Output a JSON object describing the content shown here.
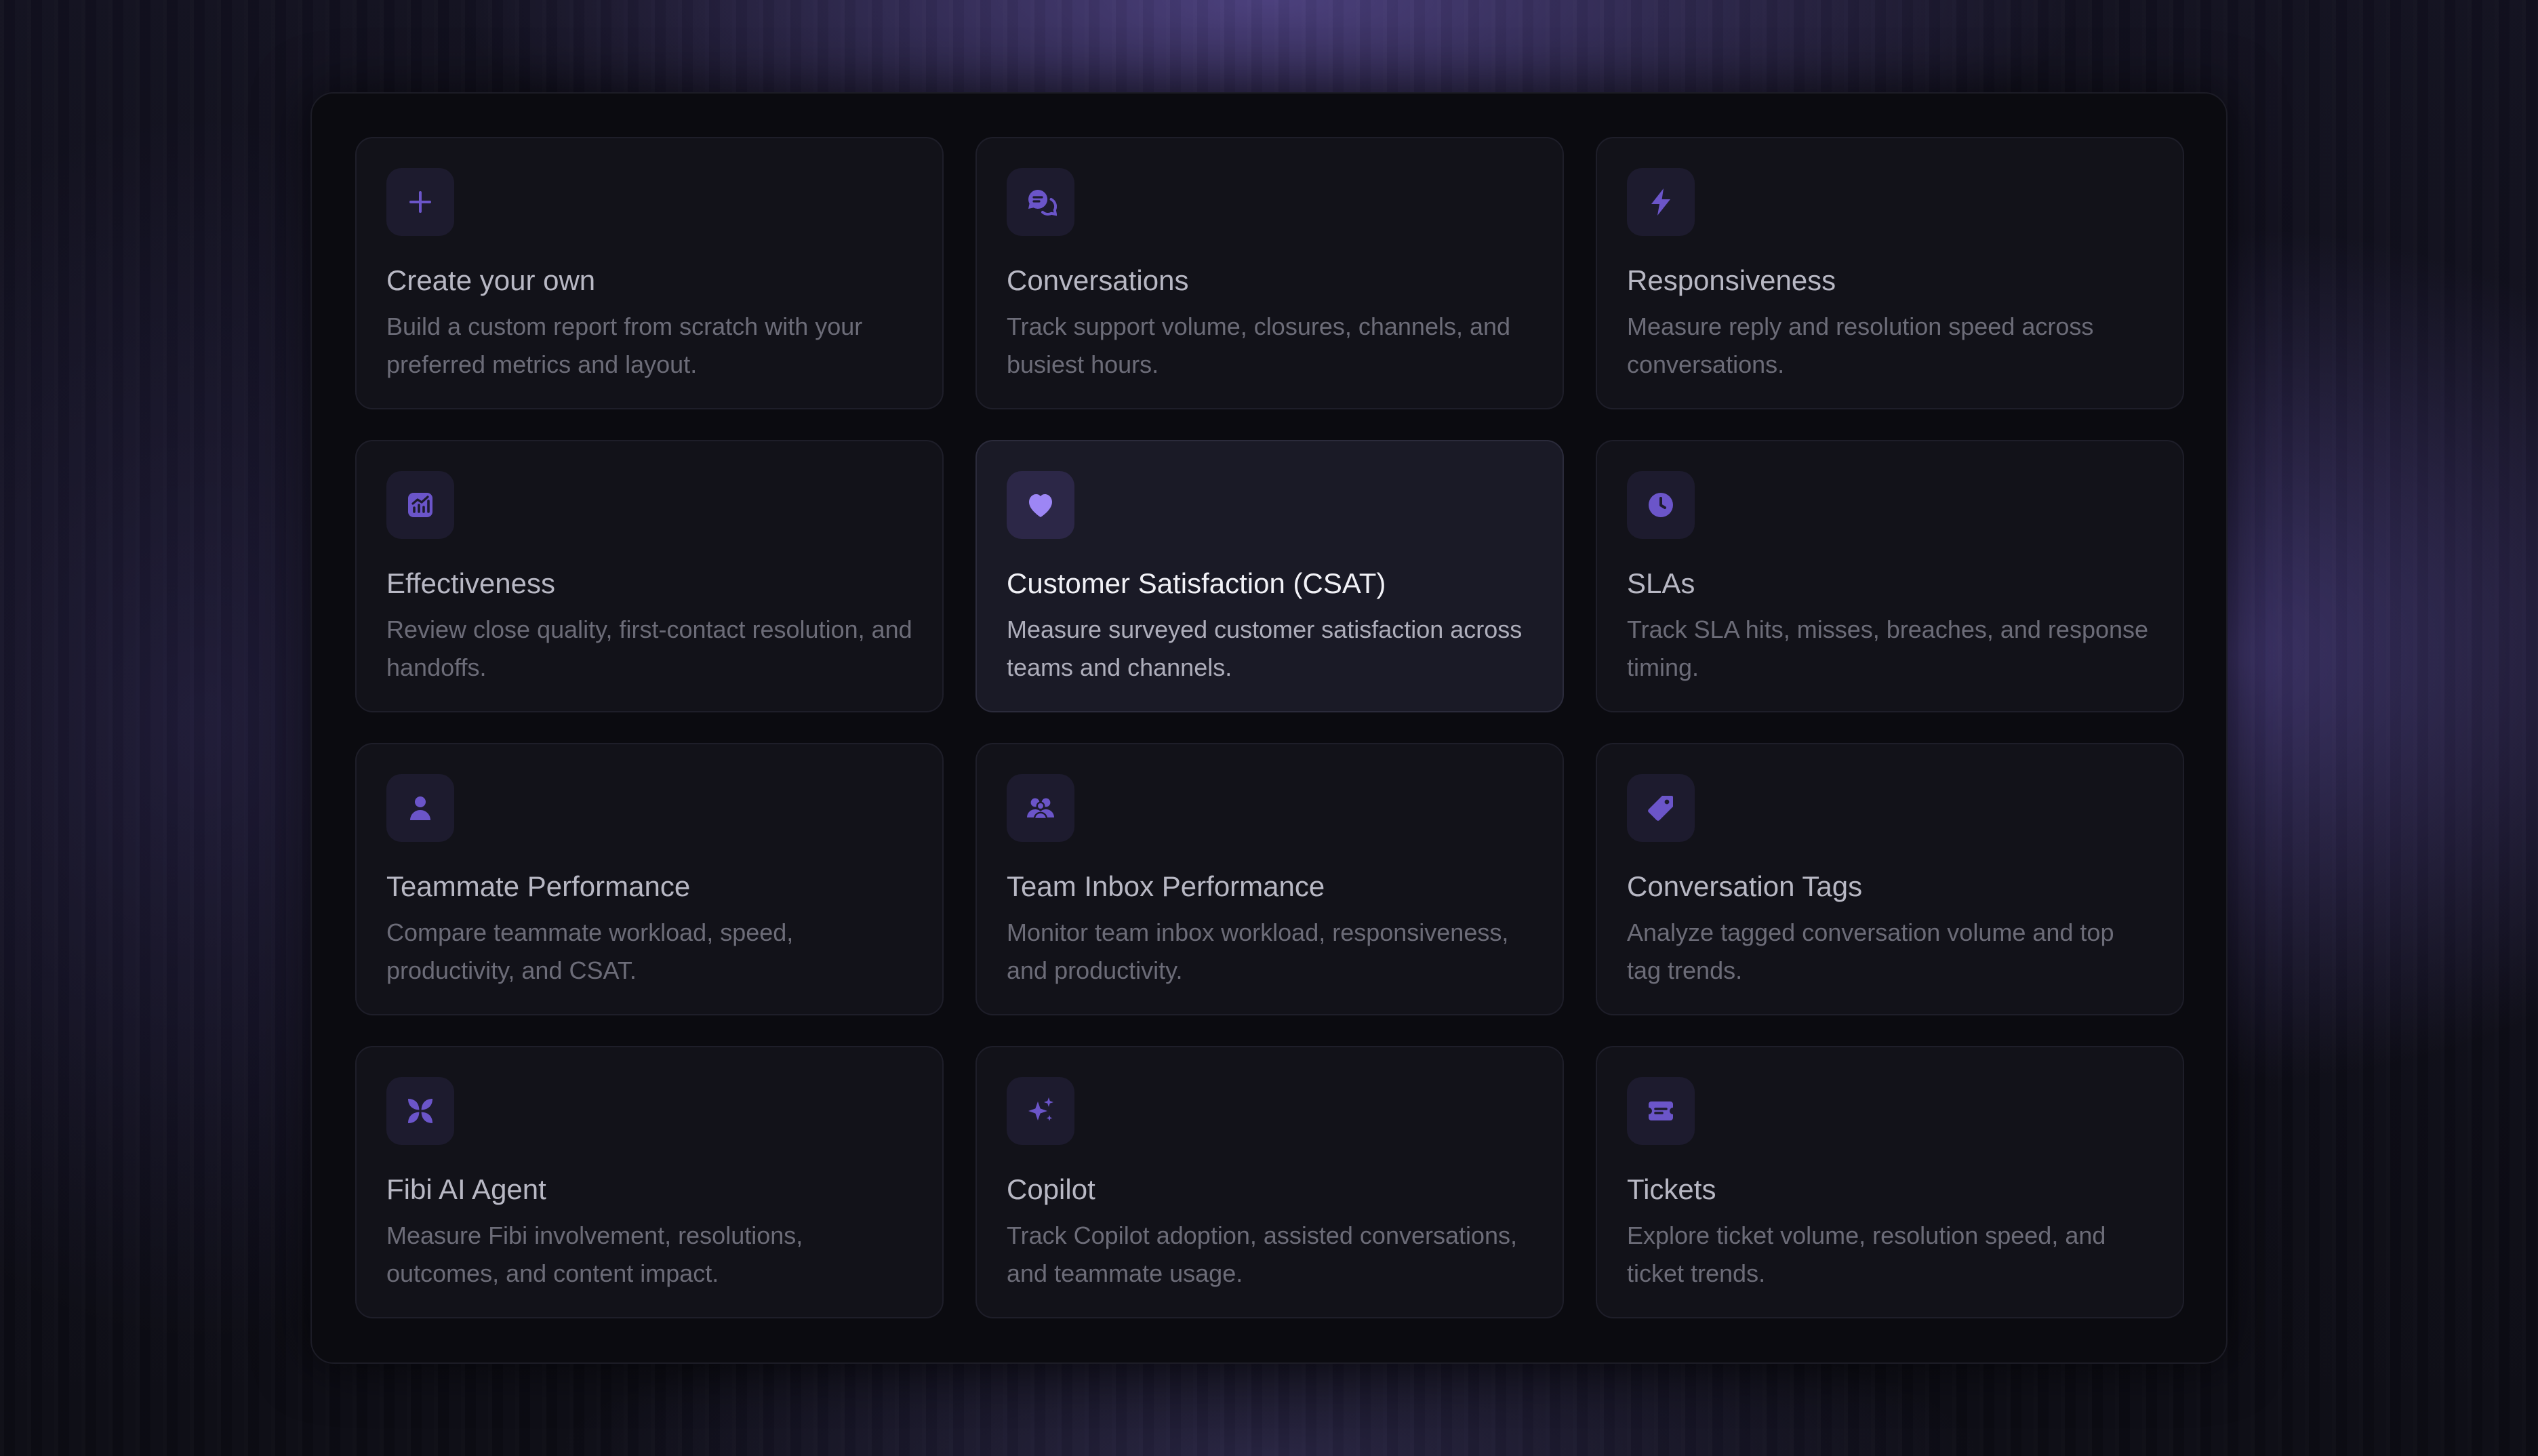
{
  "colors": {
    "accent": "#6b55c9",
    "accent_active": "#9d86f5",
    "card_bg": "#121219",
    "card_active_bg": "#1a1a26",
    "panel_bg": "#0b0b10"
  },
  "reports": [
    {
      "id": "create",
      "icon": "plus-icon",
      "title": "Create your own",
      "description": "Build a custom report from scratch with your preferred metrics and layout."
    },
    {
      "id": "conversations",
      "icon": "chat-bubbles-icon",
      "title": "Conversations",
      "description": "Track support volume, closures, channels, and busiest hours."
    },
    {
      "id": "responsiveness",
      "icon": "lightning-icon",
      "title": "Responsiveness",
      "description": "Measure reply and resolution speed across conversations."
    },
    {
      "id": "effectiveness",
      "icon": "chart-icon",
      "title": "Effectiveness",
      "description": "Review close quality, first-contact resolution, and handoffs."
    },
    {
      "id": "csat",
      "icon": "heart-icon",
      "title": "Customer Satisfaction (CSAT)",
      "description": "Measure surveyed customer satisfaction across teams and channels.",
      "selected": true
    },
    {
      "id": "slas",
      "icon": "clock-icon",
      "title": "SLAs",
      "description": "Track SLA hits, misses, breaches, and response timing."
    },
    {
      "id": "teammate",
      "icon": "person-icon",
      "title": "Teammate Performance",
      "description": "Compare teammate workload, speed, productivity, and CSAT."
    },
    {
      "id": "team-inbox",
      "icon": "group-icon",
      "title": "Team Inbox Performance",
      "description": "Monitor team inbox workload, responsiveness, and productivity."
    },
    {
      "id": "tags",
      "icon": "tag-icon",
      "title": "Conversation Tags",
      "description": "Analyze tagged conversation volume and top tag trends."
    },
    {
      "id": "fibi",
      "icon": "ai-agent-icon",
      "title": "Fibi AI Agent",
      "description": "Measure Fibi involvement, resolutions, outcomes, and content impact."
    },
    {
      "id": "copilot",
      "icon": "sparkles-icon",
      "title": "Copilot",
      "description": "Track Copilot adoption, assisted conversations, and teammate usage."
    },
    {
      "id": "tickets",
      "icon": "ticket-icon",
      "title": "Tickets",
      "description": "Explore ticket volume, resolution speed, and ticket trends."
    }
  ]
}
